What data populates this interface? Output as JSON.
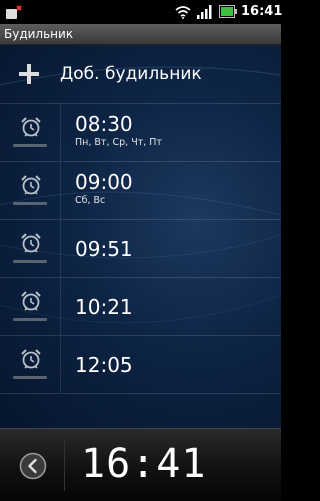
{
  "status_bar": {
    "time": "16:41",
    "icons": [
      "notification-icon",
      "wifi-icon",
      "signal-icon",
      "battery-icon"
    ]
  },
  "title_bar": {
    "title": "Будильник"
  },
  "add_alarm": {
    "label": "Доб. будильник",
    "icon": "plus-icon"
  },
  "alarms": [
    {
      "time": "08:30",
      "days": "Пн, Вт, Ср, Чт, Пт"
    },
    {
      "time": "09:00",
      "days": "Сб, Вс"
    },
    {
      "time": "09:51",
      "days": ""
    },
    {
      "time": "10:21",
      "days": ""
    },
    {
      "time": "12:05",
      "days": ""
    }
  ],
  "bottom_bar": {
    "clock": "16:41",
    "back_icon": "back-arrow-icon"
  },
  "colors": {
    "background": "#0d2444",
    "toggle_off": "#5a6470",
    "text": "#ffffff"
  }
}
